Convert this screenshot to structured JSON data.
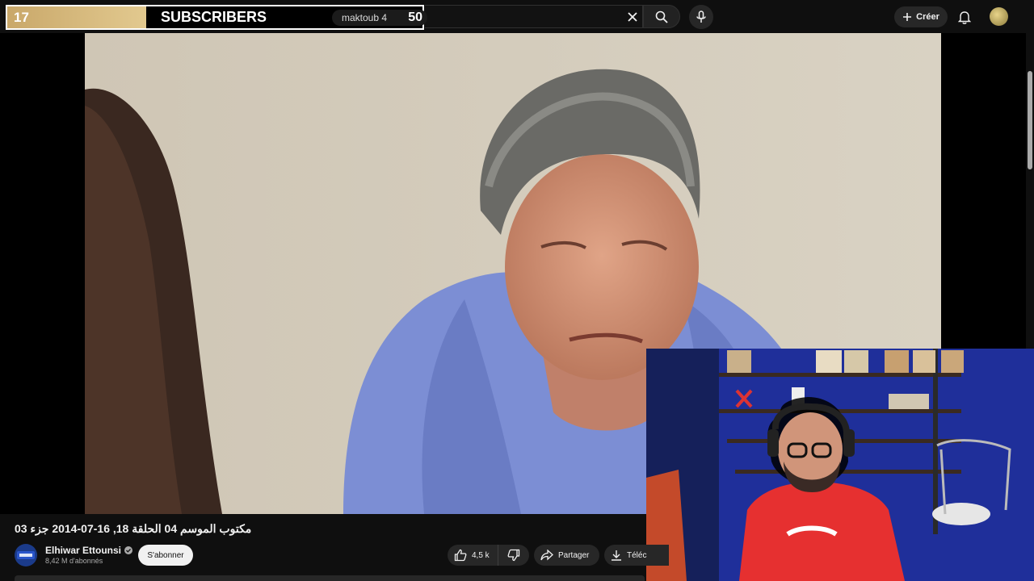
{
  "overlay": {
    "subscriber_count": "17",
    "subscriber_label": "SUBSCRIBERS",
    "search_query": "maktoub 4",
    "subscriber_goal": "50"
  },
  "header": {
    "create_label": "Créer",
    "icons": [
      "close-icon",
      "search-icon",
      "mic-icon",
      "plus-icon",
      "bell-icon",
      "avatar"
    ]
  },
  "video": {
    "title": "مكتوب الموسم 04 الحلقة 18, 16-07-2014 جزء 03"
  },
  "channel": {
    "name": "Elhiwar Ettounsi",
    "subscribers": "8,42 M d'abonnés",
    "verified_icon": "check-circle-icon"
  },
  "actions": {
    "subscribe_label": "S'abonner",
    "like_count": "4,5 k",
    "share_label": "Partager",
    "download_label": "Téléc"
  },
  "colors": {
    "background": "#0f0f0f",
    "overlay_gold": "#c9a86a",
    "pill": "#272727"
  }
}
